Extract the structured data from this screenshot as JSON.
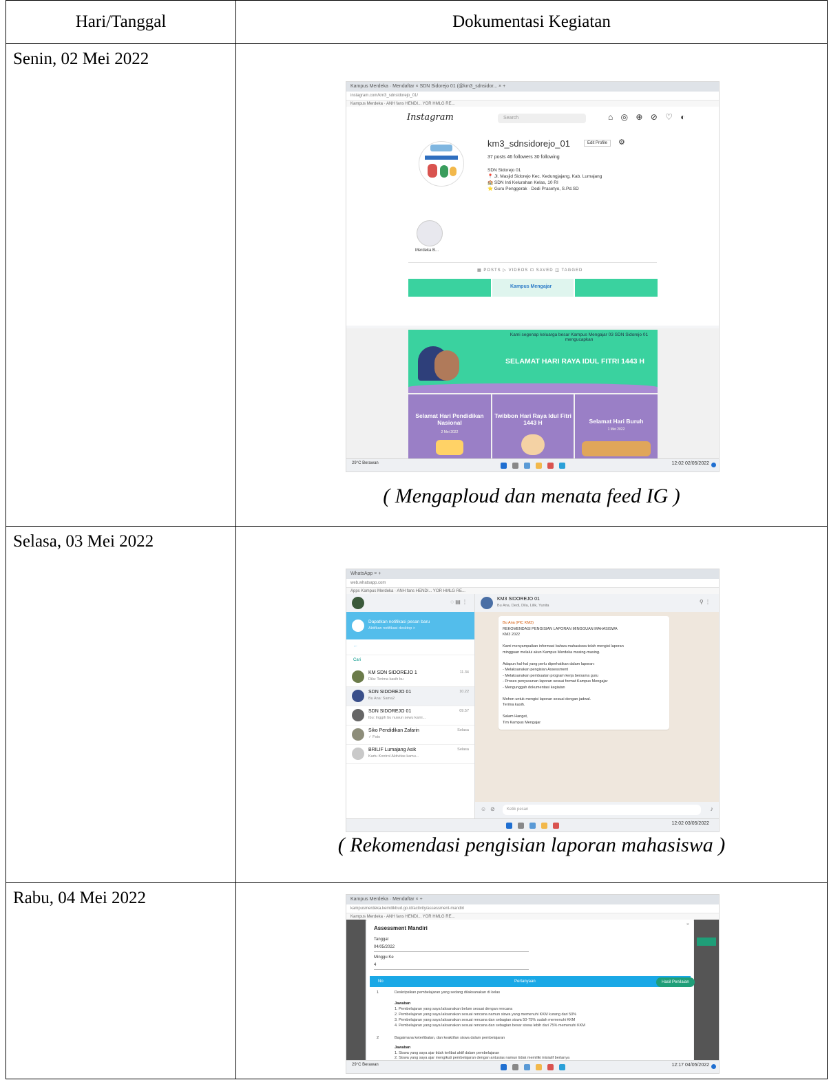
{
  "table": {
    "header": {
      "col1": "Hari/Tanggal",
      "col2": "Dokumentasi Kegiatan"
    },
    "rows": [
      {
        "date": "Senin, 02 Mei 2022",
        "caption": "( Mengaploud dan menata feed IG )"
      },
      {
        "date": "Selasa, 03 Mei 2022",
        "caption": "( Rekomendasi pengisian laporan mahasiswa )"
      },
      {
        "date": "Rabu, 04 Mei 2022",
        "caption": ""
      }
    ]
  },
  "shot1": {
    "tabs": "Kampus Merdeka · Mendaftar ×   SDN Sidorejo 01 (@km3_sdnsidor... ×  +",
    "url": "instagram.com/km3_sdnsidorejo_01/",
    "bookmarks": "Kampus Merdeka ·   ANH fans HENDI...   YOR HMLG RE...",
    "ig": {
      "logo": "Instagram",
      "search": "Search",
      "nav_icons": "⌂ ◎ ⊕ ⊘ ♡ ◐",
      "username": "km3_sdnsidorejo_01",
      "edit": "Edit Profile",
      "stats": "37 posts     46 followers     30 following",
      "bio": [
        "SDN Sidorejo 01",
        "📍 Jl. Masjid Sidorejo Kec. Kedungjajang, Kab. Lumajang",
        "🏫 SDN Inti Kelurahan Kelas, 10 RI",
        "⭐ Guru Penggerak · Dedi Prasetyo, S.Pd.SD"
      ],
      "highlight_label": "Merdeka B...",
      "tabs": "▦ POSTS      ▷ VIDEOS      ⊡ SAVED      ◫ TAGGED",
      "posts": {
        "p_mid": "Kampus Mengajar",
        "idul": "SELAMAT HARI RAYA IDUL FITRI 1443 H",
        "idul_small": "Kami segenap keluarga besar Kampus Mengajar 03 SDN Sidorejo 01 mengucapkan",
        "hardiknas": "Selamat Hari Pendidikan Nasional",
        "hardiknas_date": "2 Mei 2022",
        "twibbon": "Twibbon Hari Raya Idul Fitri 1443 H",
        "buruh": "Selamat Hari Buruh",
        "buruh_date": "1 Mei 2022"
      }
    },
    "taskbar": {
      "weather": "29°C Berawan",
      "time": "12:02 02/05/2022"
    }
  },
  "shot2": {
    "tabs": "WhatsApp  ×  +",
    "url": "web.whatsapp.com",
    "bookmarks": "Apps   Kampus Merdeka ·   ANH fans HENDI...   YOR HMLG RE...",
    "notif_title": "Dapatkan notifikasi pesan baru",
    "notif_sub": "Aktifkan notifikasi desktop >",
    "search": "Cari",
    "chats": [
      {
        "name": "KM SDN SIDOREJO 1",
        "msg": "Dila: Terima kasih bu",
        "time": "11.34"
      },
      {
        "name": "SDN SIDOREJO 01",
        "msg": "Bu Ana: Sama2",
        "time": "10.22"
      },
      {
        "name": "SDN SIDOREJO 01",
        "msg": "Ibu: Inggih bu nuwun sewu kami...",
        "time": "09.57"
      },
      {
        "name": "Siko Pendidikan Zafarin",
        "msg": "✓ Foto",
        "time": "Selasa"
      },
      {
        "name": "BRILIF Lumajang Asik",
        "msg": "Kartu Kontrol Aktivitas kamu...",
        "time": "Selasa"
      }
    ],
    "header_name": "KM3 SIDOREJO 01",
    "header_sub": "Bu Ana, Dedi, Dila, Lilik, Yunita",
    "message_lines": [
      "Bu Ana (PIC KM3)",
      "REKOMENDASI PENGISIAN LAPORAN MINGGUAN MAHASISWA",
      "KM3 2022",
      "",
      "Kami menyampaikan informasi bahwa mahasiswa telah mengisi laporan",
      "mingguan melalui akun Kampus Merdeka masing-masing.",
      "",
      "Adapun hal-hal yang perlu diperhatikan dalam laporan:",
      "- Melaksanakan pengisian Assessment",
      "- Melaksanakan pembuatan program kerja bersama guru",
      "- Proses penyusunan laporan sesuai format Kampus Mengajar",
      "- Mengunggah dokumentasi kegiatan",
      "",
      "Mohon untuk mengisi laporan sesuai dengan jadwal.",
      "Terima kasih.",
      "",
      "Salam Hangat,",
      "Tim Kampus Mengajar"
    ],
    "input": "Ketik pesan",
    "taskbar": {
      "time": "12:02 03/05/2022"
    }
  },
  "shot3": {
    "tabs": "Kampus Merdeka · Mendaftar ×  +",
    "url": "kampusmerdeka.kemdikbud.go.id/activity/assessment-mandiri",
    "bookmarks": "Kampus Merdeka ·   ANH fans HENDI...   YOR HMLG RE...",
    "title": "Assessment Mandiri",
    "label_date": "Tanggal",
    "date_value": "04/05/2022",
    "label_week": "Minggu Ke",
    "week_value": "4",
    "thead_no": "No",
    "thead_q": "Pertanyaan",
    "q1": "Deskripsikan pembelajaran yang sedang dilaksanakan di kelas",
    "answer_label": "Jawaban",
    "options": [
      "1. Pembelajaran yang saya laksanakan belum sesuai dengan rencana",
      "2. Pembelajaran yang saya laksanakan sesuai rencana namun siswa yang memenuhi KKM kurang dari 50%",
      "3. Pembelajaran yang saya laksanakan sesuai rencana dan sebagian siswa 50-75% sudah memenuhi KKM",
      "4. Pembelajaran yang saya laksanakan sesuai rencana dan sebagian besar siswa lebih dari 75% memenuhi KKM"
    ],
    "q2": "Bagaimana keterlibatan, dan keaktifan siswa dalam pembelajaran",
    "options2": [
      "1. Siswa yang saya ajar tidak terlibat aktif dalam pembelajaran",
      "2. Siswa yang saya ajar mengikuti pembelajaran dengan antusias namun tidak memiliki inisiatif bertanya"
    ],
    "fab": "Hasil Penilaian",
    "taskbar": {
      "weather": "29°C Berawan",
      "time": "12:17 04/05/2022"
    }
  },
  "colors": {
    "ig_green": "#3ad29f",
    "ig_purple": "#9a7fc6",
    "wa_blue": "#53bdeb",
    "as_blue": "#1aa8e6"
  }
}
